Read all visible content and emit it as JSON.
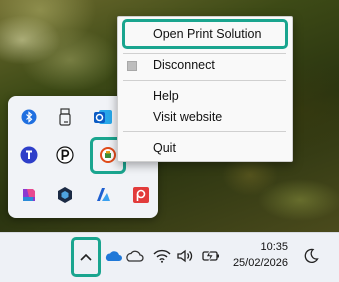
{
  "context_menu": {
    "items": [
      {
        "label": "Open Print Solution",
        "highlighted": true
      },
      {
        "label": "Disconnect",
        "has_checkbox": true
      },
      {
        "label": "Help"
      },
      {
        "label": "Visit website"
      },
      {
        "label": "Quit"
      }
    ]
  },
  "flyout": {
    "icons": [
      {
        "name": "bluetooth-icon",
        "glyph": "ᛒ",
        "color": "#1f6fe0"
      },
      {
        "name": "usb-drive-icon",
        "glyph": "▯",
        "color": "#444444"
      },
      {
        "name": "outlook-icon",
        "glyph": "o",
        "color": "#0a5bc4"
      },
      {
        "name": "teams-icon",
        "glyph": "t",
        "color": "#2e3ec9"
      },
      {
        "name": "pixel-app-icon",
        "glyph": "P",
        "color": "#111111"
      },
      {
        "name": "print-solution-icon",
        "glyph": "",
        "color": "#e04b1a"
      },
      {
        "name": "copilot-icon",
        "glyph": "",
        "color": "#c43ad0"
      },
      {
        "name": "shield-app-icon",
        "glyph": "",
        "color": "#1b2a44"
      },
      {
        "name": "azure-icon",
        "glyph": "",
        "color": "#1e88e5"
      },
      {
        "name": "pdf-app-icon",
        "glyph": "p",
        "color": "#e23b3b"
      }
    ]
  },
  "taskbar": {
    "time": "10:35",
    "date": "25/02/2026"
  },
  "colors": {
    "highlight_outline": "#1aa58f"
  }
}
